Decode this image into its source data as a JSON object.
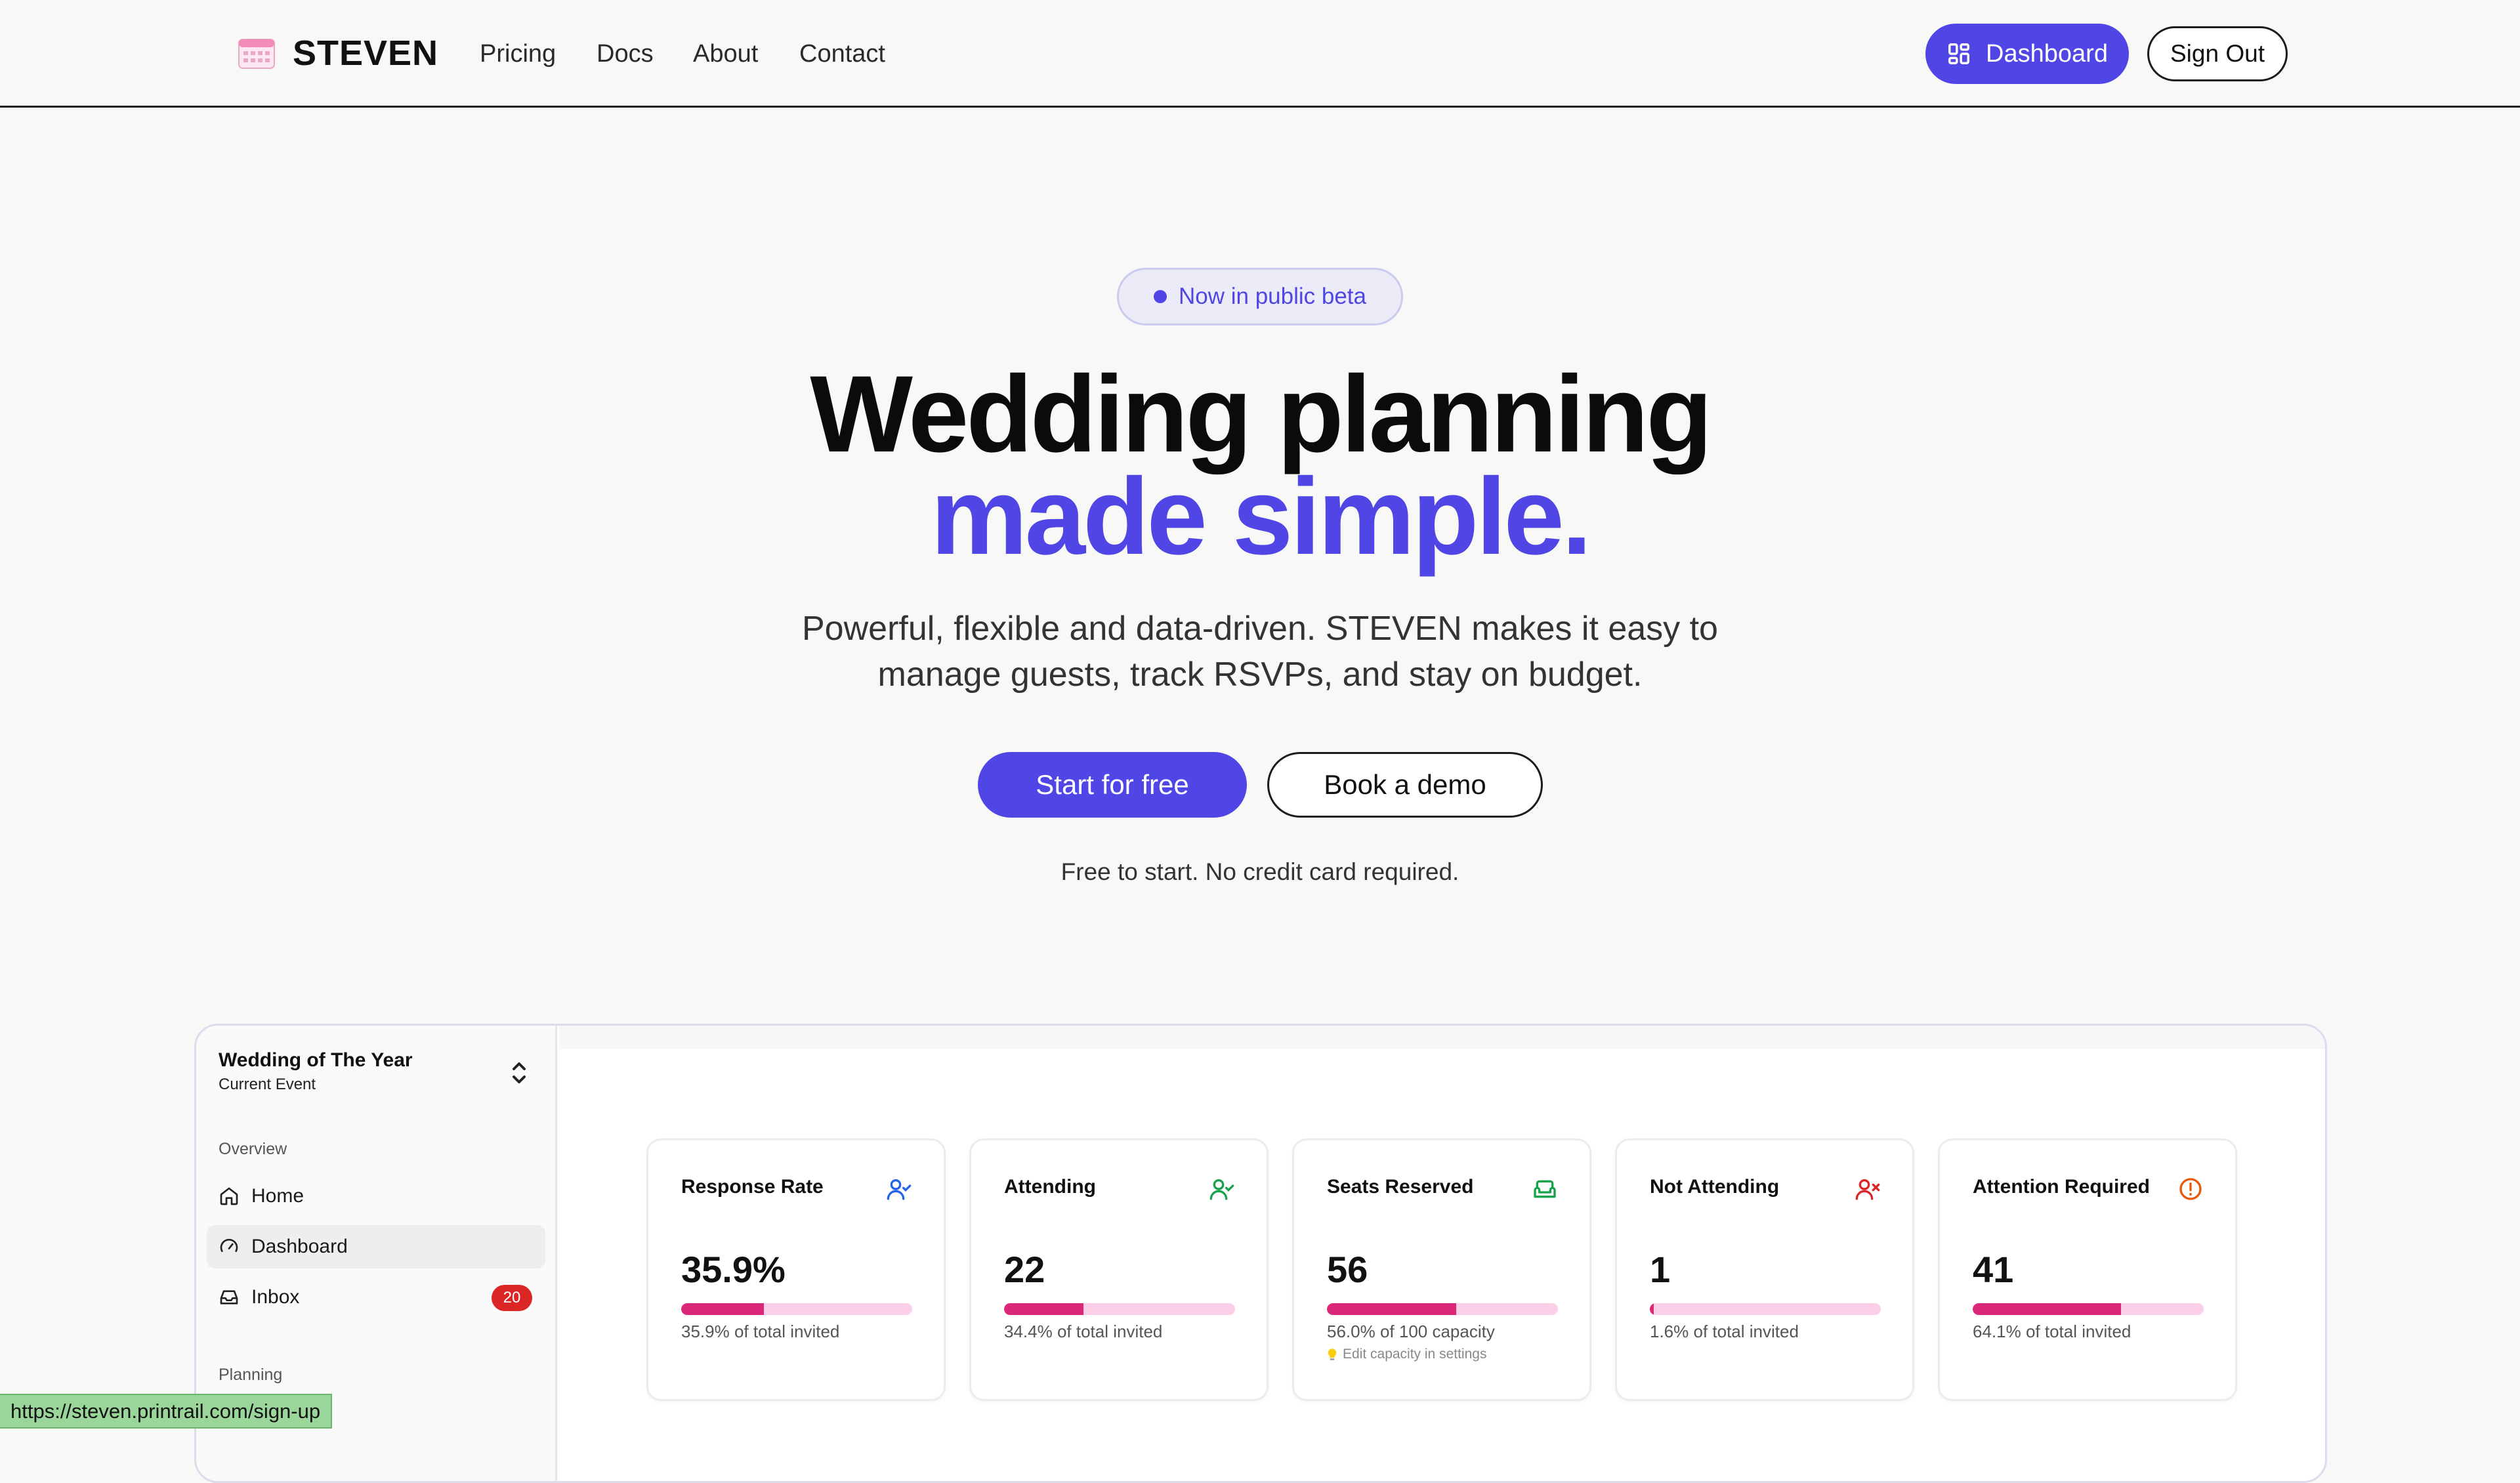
{
  "nav": {
    "brand": "STEVEN",
    "links": [
      "Pricing",
      "Docs",
      "About",
      "Contact"
    ],
    "dashboard_label": "Dashboard",
    "signout_label": "Sign Out"
  },
  "hero": {
    "badge": "Now in public beta",
    "title_line1": "Wedding planning",
    "title_line2": "made simple.",
    "subtitle_line1": "Powerful, flexible and data-driven. STEVEN makes it easy to",
    "subtitle_line2": "manage guests, track RSVPs, and stay on budget.",
    "cta_primary": "Start for free",
    "cta_secondary": "Book a demo",
    "note": "Free to start. No credit card required."
  },
  "preview": {
    "event_name": "Wedding of The Year",
    "event_sub": "Current Event",
    "sections": {
      "overview": "Overview",
      "planning": "Planning"
    },
    "sidebar_items": [
      {
        "label": "Home",
        "icon": "home-icon"
      },
      {
        "label": "Dashboard",
        "icon": "gauge-icon",
        "active": true
      },
      {
        "label": "Inbox",
        "icon": "inbox-icon",
        "badge": "20"
      }
    ],
    "cards": [
      {
        "title": "Response Rate",
        "icon": "user-check-icon",
        "icon_color": "#2563eb",
        "value": "35.9%",
        "progress": 0.359,
        "desc": "35.9% of total invited"
      },
      {
        "title": "Attending",
        "icon": "user-check-icon",
        "icon_color": "#16a34a",
        "value": "22",
        "progress": 0.344,
        "desc": "34.4% of total invited"
      },
      {
        "title": "Seats Reserved",
        "icon": "sofa-icon",
        "icon_color": "#16a34a",
        "value": "56",
        "progress": 0.56,
        "desc": "56.0% of 100 capacity",
        "hint": "Edit capacity in settings"
      },
      {
        "title": "Not Attending",
        "icon": "user-x-icon",
        "icon_color": "#dc2626",
        "value": "1",
        "progress": 0.016,
        "desc": "1.6% of total invited"
      },
      {
        "title": "Attention Required",
        "icon": "alert-circle-icon",
        "icon_color": "#ea580c",
        "value": "41",
        "progress": 0.641,
        "desc": "64.1% of total invited"
      }
    ]
  },
  "status_url": "https://steven.printrail.com/sign-up",
  "colors": {
    "accent": "#4f46e5",
    "progress_fill": "#db2777",
    "progress_track": "#fbcfe8",
    "badge_red": "#dc2626"
  }
}
